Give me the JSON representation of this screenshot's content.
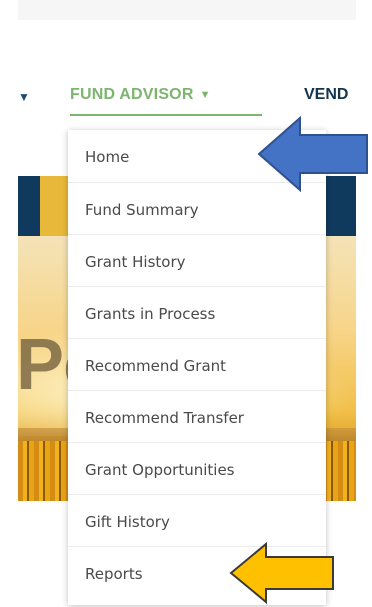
{
  "nav": {
    "fund_advisor": "FUND ADVISOR",
    "next_item": "VEND"
  },
  "dropdown": {
    "items": [
      {
        "label": "Home"
      },
      {
        "label": "Fund Summary"
      },
      {
        "label": "Grant History"
      },
      {
        "label": "Grants in Process"
      },
      {
        "label": "Recommend Grant"
      },
      {
        "label": "Recommend Transfer"
      },
      {
        "label": "Grant Opportunities"
      },
      {
        "label": "Gift History"
      },
      {
        "label": "Reports"
      }
    ]
  },
  "hero": {
    "visible_text": "Po"
  },
  "annotations": {
    "blue_arrow_color": "#4472c4",
    "gold_arrow_color": "#ffc000"
  }
}
